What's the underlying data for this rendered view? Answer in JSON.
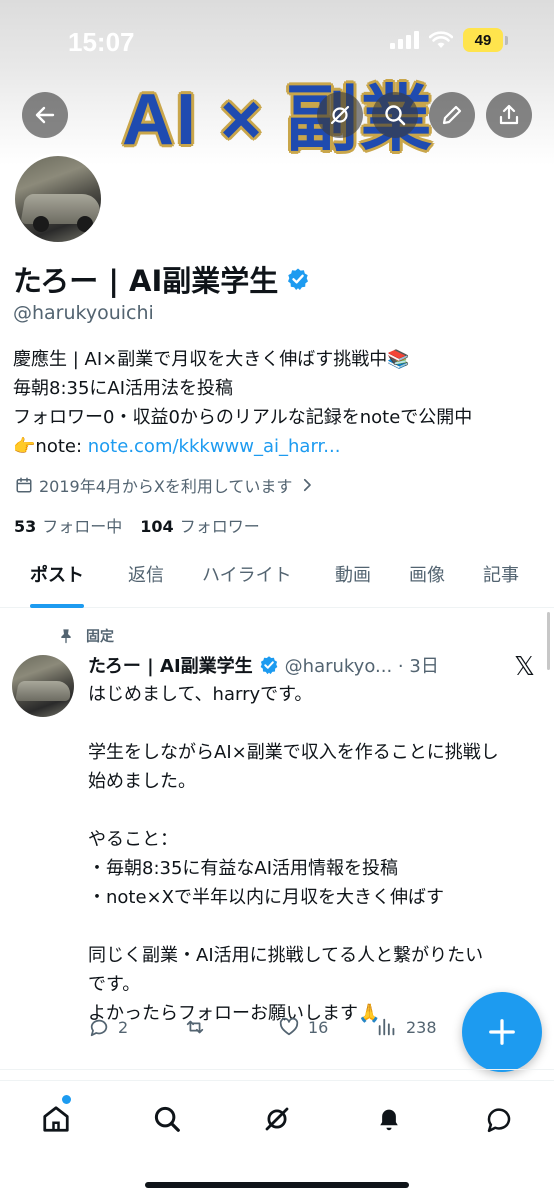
{
  "status_bar": {
    "time": "15:07",
    "battery": "49"
  },
  "banner": {
    "text": "AI × 副業"
  },
  "profile": {
    "display_name": "たろー | AI副業学生",
    "handle": "@harukyouichi",
    "bio_lines": [
      "慶應生 | AI×副業で月収を大きく伸ばす挑戦中📚",
      "毎朝8:35にAI活用法を投稿",
      "フォロワー0・収益0からのリアルな記録をnoteで公開中"
    ],
    "bio_link_prefix": "👉note: ",
    "bio_link": "note.com/kkkwww_ai_harr...",
    "joined": "2019年4月からXを利用しています",
    "following_count": "53",
    "following_label": "フォロー中",
    "followers_count": "104",
    "followers_label": "フォロワー"
  },
  "tabs": [
    "ポスト",
    "返信",
    "ハイライト",
    "動画",
    "画像",
    "記事"
  ],
  "post": {
    "pinned_label": "固定",
    "name": "たろー | AI副業学生",
    "handle_time": "@harukyo... · 3日",
    "lines": [
      "はじめまして、harryです。",
      "",
      "学生をしながらAI×副業で収入を作ることに挑戦し",
      "始めました。",
      "",
      "やること：",
      "・毎朝8:35に有益なAI活用情報を投稿",
      "・note×Xで半年以内に月収を大きく伸ばす",
      "",
      "同じく副業・AI活用に挑戦してる人と繋がりたい",
      "です。",
      "よかったらフォローお願いします🙏"
    ],
    "replies": "2",
    "likes": "16",
    "views": "238"
  },
  "icons": {
    "back": "back-arrow-icon",
    "grok": "grok-icon",
    "search": "search-icon",
    "edit": "edit-icon",
    "share": "share-icon",
    "compose": "plus-icon"
  },
  "colors": {
    "accent": "#1d9bf0",
    "text": "#0f1419",
    "muted": "#536471"
  }
}
